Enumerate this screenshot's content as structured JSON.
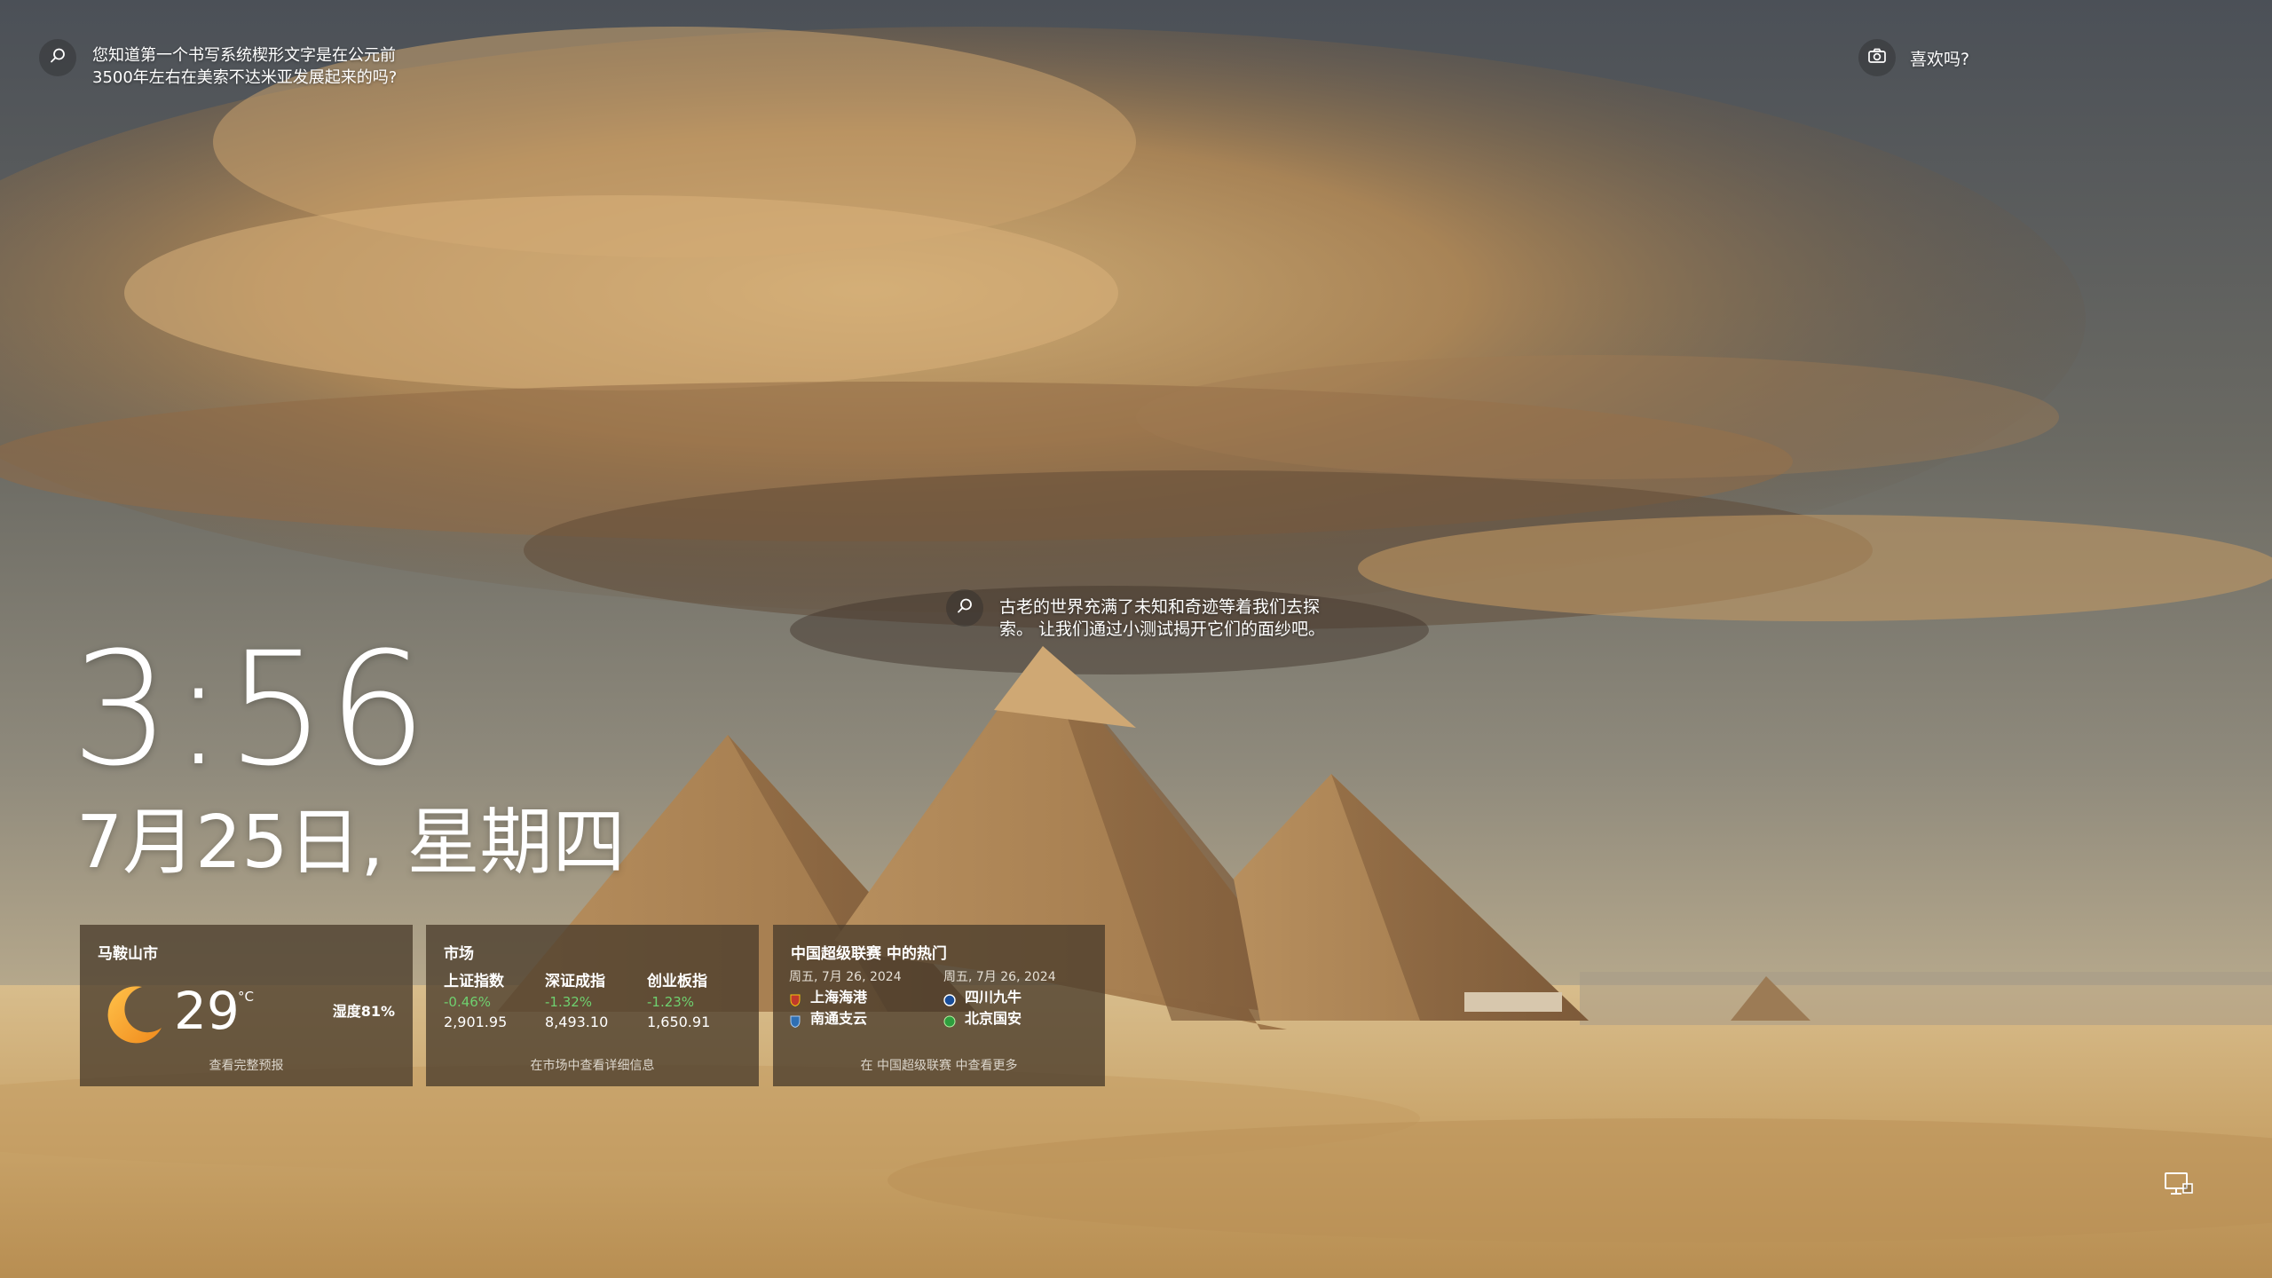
{
  "spotlight": {
    "fact_text": "您知道第一个书写系统楔形文字是在公元前3500年左右在美索不达米亚发展起来的吗?",
    "like_text": "喜欢吗?",
    "hotspot_text": "古老的世界充满了未知和奇迹等着我们去探索。 让我们通过小测试揭开它们的面纱吧。"
  },
  "lockscreen": {
    "time": "3:56",
    "date": "7月25日, 星期四"
  },
  "weather": {
    "city": "马鞍山市",
    "temperature": "29",
    "unit": "°C",
    "humidity": "湿度81%",
    "footer": "查看完整预报",
    "icon": "moon-icon"
  },
  "market": {
    "title": "市场",
    "footer": "在市场中查看详细信息",
    "stocks": [
      {
        "name": "上证指数",
        "change": "-0.46%",
        "value": "2,901.95"
      },
      {
        "name": "深证成指",
        "change": "-1.32%",
        "value": "8,493.10"
      },
      {
        "name": "创业板指",
        "change": "-1.23%",
        "value": "1,650.91"
      }
    ],
    "change_color": "#6fd06f"
  },
  "sports": {
    "title": "中国超级联赛 中的热门",
    "footer": "在 中国超级联赛 中查看更多",
    "matches": [
      {
        "date": "周五, 7月 26, 2024",
        "team1": "上海海港",
        "team2": "南通支云",
        "team1_color": "#c0392b",
        "team2_color": "#2f6fb3"
      },
      {
        "date": "周五, 7月 26, 2024",
        "team1": "四川九牛",
        "team2": "北京国安",
        "team1_color": "#1a4e9a",
        "team2_color": "#2e9e3e"
      }
    ]
  },
  "icons": {
    "search": "search-icon",
    "camera": "camera-icon",
    "network": "network-icon"
  }
}
